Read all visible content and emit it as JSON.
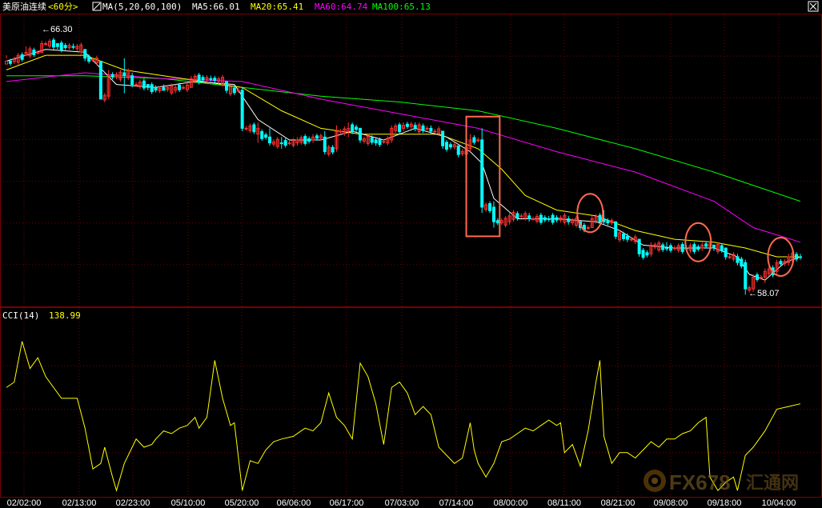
{
  "header": {
    "symbol": "美原油连续",
    "period": "<60分>",
    "ma_label": "MA(5,20,60,100)",
    "ma5": "MA5:66.01",
    "ma20": "MA20:65.41",
    "ma60": "MA60:64.74",
    "ma100": "MA100:65.13"
  },
  "colors": {
    "background": "#000000",
    "grid": "#7a0000",
    "up": "#ff3030",
    "down": "#00ffff",
    "ma5": "#ffffff",
    "ma20": "#ffff00",
    "ma60": "#ff00ff",
    "ma100": "#00ff00",
    "cci": "#ffff00",
    "annotation": "#ff6a4d"
  },
  "price_labels": {
    "high": "66.30",
    "low": "58.07"
  },
  "cci_header": {
    "label": "CCI(14)",
    "value": "138.99"
  },
  "x_ticks": [
    "02/02:00",
    "02/13:00",
    "02/23:00",
    "05/10:00",
    "05/20:00",
    "06/06:00",
    "06/17:00",
    "07/03:00",
    "07/14:00",
    "08/00:00",
    "08/11:00",
    "08/21:00",
    "09/08:00",
    "09/18:00",
    "10/04:00"
  ],
  "watermark": {
    "text": "FX678",
    "cn": "汇通网",
    "icon": "fx678-logo-icon"
  },
  "chart_data": {
    "type": "candlestick",
    "price_ylim": [
      57.2,
      67.2
    ],
    "candles_anchor": [
      [
        0,
        65.6,
        65.8,
        65.7,
        65.5,
        1
      ],
      [
        5,
        65.8,
        66.1,
        65.8,
        65.9,
        1
      ],
      [
        9,
        65.9,
        66.3,
        65.9,
        66.2,
        1
      ],
      [
        13,
        66.2,
        66.2,
        66.0,
        66.1,
        0
      ],
      [
        17,
        66.1,
        66.2,
        66.0,
        66.1,
        0
      ],
      [
        20,
        66.0,
        66.0,
        65.6,
        65.7,
        0
      ],
      [
        24,
        65.6,
        65.6,
        64.3,
        64.3,
        0
      ],
      [
        26,
        64.4,
        65.3,
        64.3,
        65.1,
        1
      ],
      [
        30,
        65.1,
        65.7,
        64.5,
        65.2,
        0
      ],
      [
        32,
        65.1,
        65.2,
        64.7,
        64.8,
        0
      ],
      [
        36,
        64.8,
        64.8,
        64.6,
        64.7,
        0
      ],
      [
        40,
        64.6,
        64.8,
        64.6,
        64.7,
        0
      ],
      [
        43,
        64.6,
        64.8,
        64.5,
        64.7,
        1
      ],
      [
        47,
        64.7,
        65.1,
        64.7,
        65.0,
        1
      ],
      [
        52,
        65.0,
        65.1,
        64.9,
        65.0,
        0
      ],
      [
        56,
        64.9,
        64.9,
        64.5,
        64.6,
        0
      ],
      [
        60,
        64.6,
        64.7,
        63.2,
        63.3,
        0
      ],
      [
        64,
        63.3,
        63.5,
        62.8,
        63.1,
        1
      ],
      [
        67,
        63.0,
        63.3,
        62.7,
        62.8,
        0
      ],
      [
        70,
        62.8,
        63.0,
        62.6,
        62.8,
        0
      ],
      [
        74,
        62.8,
        63.0,
        62.7,
        62.9,
        1
      ],
      [
        78,
        62.9,
        63.1,
        62.8,
        63.0,
        1
      ],
      [
        81,
        63.0,
        63.2,
        62.4,
        62.5,
        0
      ],
      [
        84,
        62.6,
        63.4,
        62.5,
        63.2,
        1
      ],
      [
        87,
        63.2,
        63.5,
        63.0,
        63.3,
        1
      ],
      [
        90,
        63.3,
        63.3,
        62.8,
        62.9,
        0
      ],
      [
        94,
        62.9,
        63.0,
        62.7,
        62.8,
        0
      ],
      [
        98,
        62.9,
        63.4,
        62.8,
        63.3,
        1
      ],
      [
        101,
        63.3,
        63.5,
        63.2,
        63.4,
        1
      ],
      [
        104,
        63.4,
        63.5,
        63.2,
        63.3,
        0
      ],
      [
        108,
        63.3,
        63.4,
        63.1,
        63.2,
        0
      ],
      [
        111,
        63.2,
        63.2,
        62.6,
        62.7,
        0
      ],
      [
        115,
        62.7,
        62.7,
        62.3,
        62.4,
        0
      ],
      [
        118,
        62.6,
        63.1,
        62.5,
        62.9,
        1
      ],
      [
        121,
        62.9,
        63.3,
        60.4,
        60.6,
        0
      ],
      [
        124,
        60.6,
        60.8,
        59.9,
        60.1,
        0
      ],
      [
        128,
        60.1,
        60.4,
        60.0,
        60.3,
        1
      ],
      [
        133,
        60.3,
        60.4,
        60.1,
        60.2,
        0
      ],
      [
        138,
        60.2,
        60.3,
        60.1,
        60.2,
        0
      ],
      [
        143,
        60.2,
        60.3,
        60.0,
        60.1,
        0
      ],
      [
        146,
        60.1,
        60.1,
        59.8,
        59.9,
        0
      ],
      [
        149,
        59.9,
        60.3,
        59.9,
        60.2,
        1
      ],
      [
        152,
        60.2,
        60.5,
        60.0,
        60.1,
        0
      ],
      [
        155,
        60.1,
        60.1,
        59.5,
        59.6,
        0
      ],
      [
        158,
        59.6,
        59.7,
        59.4,
        59.5,
        0
      ],
      [
        161,
        59.5,
        59.5,
        58.9,
        59.0,
        0
      ],
      [
        164,
        59.0,
        59.4,
        58.9,
        59.3,
        1
      ],
      [
        168,
        59.2,
        59.4,
        59.1,
        59.2,
        0
      ],
      [
        173,
        59.2,
        59.3,
        59.1,
        59.2,
        0
      ],
      [
        177,
        59.2,
        59.4,
        59.1,
        59.3,
        1
      ],
      [
        180,
        59.3,
        59.3,
        59.1,
        59.2,
        0
      ],
      [
        183,
        59.2,
        59.2,
        58.8,
        58.9,
        0
      ],
      [
        186,
        58.9,
        59.0,
        58.6,
        58.7,
        0
      ],
      [
        188,
        58.7,
        58.8,
        57.6,
        57.8,
        0
      ],
      [
        190,
        57.8,
        58.3,
        57.7,
        58.2,
        1
      ],
      [
        193,
        58.2,
        58.5,
        58.0,
        58.4,
        1
      ],
      [
        196,
        58.4,
        58.8,
        58.3,
        58.7,
        1
      ],
      [
        199,
        58.7,
        59.0,
        58.6,
        58.9,
        1
      ],
      [
        202,
        58.9,
        59.0,
        58.8,
        58.9,
        0
      ]
    ],
    "ma5": [
      [
        0,
        65.6
      ],
      [
        10,
        66.0
      ],
      [
        20,
        65.9
      ],
      [
        28,
        64.8
      ],
      [
        38,
        64.7
      ],
      [
        48,
        64.9
      ],
      [
        58,
        64.8
      ],
      [
        64,
        63.6
      ],
      [
        72,
        62.9
      ],
      [
        80,
        62.9
      ],
      [
        88,
        63.2
      ],
      [
        96,
        62.9
      ],
      [
        104,
        63.3
      ],
      [
        112,
        63.0
      ],
      [
        118,
        62.5
      ],
      [
        121,
        62.1
      ],
      [
        124,
        60.9
      ],
      [
        130,
        60.2
      ],
      [
        140,
        60.2
      ],
      [
        150,
        60.1
      ],
      [
        156,
        59.8
      ],
      [
        162,
        59.3
      ],
      [
        170,
        59.2
      ],
      [
        180,
        59.2
      ],
      [
        186,
        58.9
      ],
      [
        189,
        58.3
      ],
      [
        193,
        58.1
      ],
      [
        198,
        58.7
      ],
      [
        202,
        58.9
      ]
    ],
    "ma20": [
      [
        0,
        65.3
      ],
      [
        10,
        65.8
      ],
      [
        20,
        65.8
      ],
      [
        30,
        65.3
      ],
      [
        40,
        65.1
      ],
      [
        50,
        64.9
      ],
      [
        60,
        64.7
      ],
      [
        70,
        63.9
      ],
      [
        80,
        63.3
      ],
      [
        90,
        63.1
      ],
      [
        100,
        63.1
      ],
      [
        110,
        63.1
      ],
      [
        120,
        62.6
      ],
      [
        126,
        61.9
      ],
      [
        132,
        61.0
      ],
      [
        140,
        60.5
      ],
      [
        150,
        60.3
      ],
      [
        160,
        59.8
      ],
      [
        170,
        59.5
      ],
      [
        180,
        59.4
      ],
      [
        188,
        59.2
      ],
      [
        196,
        58.9
      ],
      [
        202,
        58.9
      ]
    ],
    "ma60": [
      [
        0,
        64.9
      ],
      [
        20,
        65.2
      ],
      [
        40,
        65.0
      ],
      [
        60,
        64.9
      ],
      [
        80,
        64.3
      ],
      [
        100,
        63.8
      ],
      [
        120,
        63.3
      ],
      [
        140,
        62.5
      ],
      [
        160,
        61.8
      ],
      [
        180,
        60.8
      ],
      [
        190,
        59.9
      ],
      [
        202,
        59.4
      ]
    ],
    "ma100": [
      [
        0,
        65.1
      ],
      [
        20,
        65.1
      ],
      [
        40,
        65.0
      ],
      [
        60,
        64.7
      ],
      [
        80,
        64.4
      ],
      [
        100,
        64.2
      ],
      [
        120,
        63.9
      ],
      [
        140,
        63.3
      ],
      [
        160,
        62.6
      ],
      [
        180,
        61.8
      ],
      [
        202,
        60.8
      ]
    ],
    "cci_ylim": [
      -320,
      320
    ],
    "cci": [
      [
        0,
        80
      ],
      [
        2,
        100
      ],
      [
        4,
        250
      ],
      [
        6,
        150
      ],
      [
        8,
        190
      ],
      [
        10,
        120
      ],
      [
        14,
        40
      ],
      [
        18,
        40
      ],
      [
        20,
        -70
      ],
      [
        22,
        -220
      ],
      [
        24,
        -200
      ],
      [
        25,
        -140
      ],
      [
        27,
        -250
      ],
      [
        28,
        -300
      ],
      [
        30,
        -200
      ],
      [
        33,
        -110
      ],
      [
        35,
        -140
      ],
      [
        37,
        -130
      ],
      [
        38,
        -110
      ],
      [
        40,
        -80
      ],
      [
        42,
        -90
      ],
      [
        44,
        -70
      ],
      [
        46,
        -60
      ],
      [
        48,
        -30
      ],
      [
        49,
        -70
      ],
      [
        51,
        -30
      ],
      [
        53,
        180
      ],
      [
        55,
        40
      ],
      [
        57,
        -60
      ],
      [
        58,
        -50
      ],
      [
        60,
        -300
      ],
      [
        62,
        -190
      ],
      [
        64,
        -200
      ],
      [
        66,
        -150
      ],
      [
        68,
        -120
      ],
      [
        70,
        -110
      ],
      [
        73,
        -100
      ],
      [
        76,
        -70
      ],
      [
        78,
        -80
      ],
      [
        80,
        -50
      ],
      [
        82,
        60
      ],
      [
        84,
        -30
      ],
      [
        86,
        -60
      ],
      [
        88,
        -110
      ],
      [
        90,
        170
      ],
      [
        92,
        120
      ],
      [
        94,
        20
      ],
      [
        96,
        -130
      ],
      [
        98,
        80
      ],
      [
        100,
        100
      ],
      [
        102,
        60
      ],
      [
        104,
        -20
      ],
      [
        106,
        10
      ],
      [
        108,
        -20
      ],
      [
        110,
        -140
      ],
      [
        112,
        -170
      ],
      [
        114,
        -200
      ],
      [
        116,
        -180
      ],
      [
        118,
        -50
      ],
      [
        119,
        -150
      ],
      [
        120,
        -200
      ],
      [
        122,
        -250
      ],
      [
        124,
        -200
      ],
      [
        126,
        -120
      ],
      [
        128,
        -110
      ],
      [
        130,
        -90
      ],
      [
        132,
        -70
      ],
      [
        134,
        -80
      ],
      [
        136,
        -60
      ],
      [
        138,
        -40
      ],
      [
        140,
        -60
      ],
      [
        141,
        -50
      ],
      [
        142,
        -160
      ],
      [
        144,
        -130
      ],
      [
        146,
        -210
      ],
      [
        148,
        -80
      ],
      [
        150,
        100
      ],
      [
        151,
        180
      ],
      [
        152,
        -100
      ],
      [
        154,
        -200
      ],
      [
        156,
        -160
      ],
      [
        158,
        -160
      ],
      [
        160,
        -180
      ],
      [
        162,
        -150
      ],
      [
        164,
        -120
      ],
      [
        166,
        -140
      ],
      [
        168,
        -110
      ],
      [
        170,
        -110
      ],
      [
        172,
        -90
      ],
      [
        174,
        -80
      ],
      [
        176,
        -50
      ],
      [
        178,
        -30
      ],
      [
        179,
        -250
      ],
      [
        181,
        -300
      ],
      [
        183,
        -270
      ],
      [
        185,
        -250
      ],
      [
        186,
        -300
      ],
      [
        188,
        -170
      ],
      [
        190,
        -140
      ],
      [
        193,
        -80
      ],
      [
        196,
        0
      ],
      [
        199,
        10
      ],
      [
        202,
        20
      ]
    ]
  }
}
